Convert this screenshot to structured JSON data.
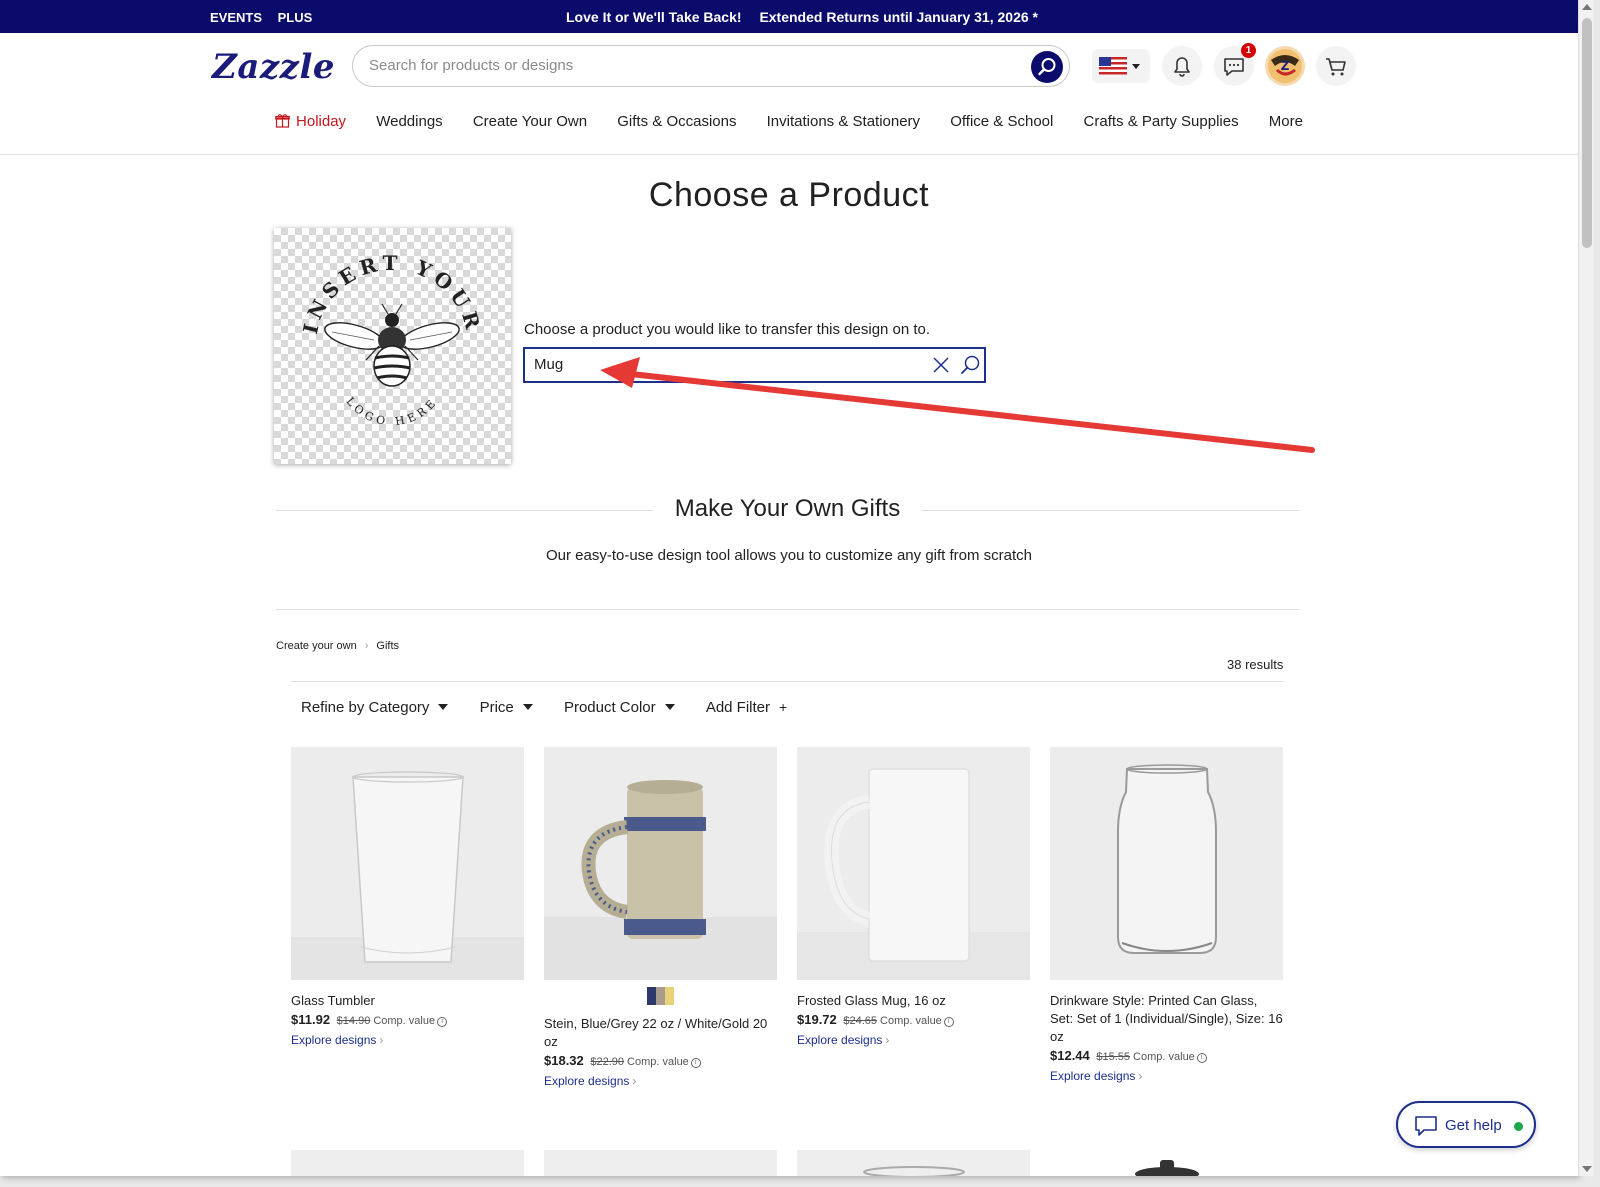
{
  "promo": {
    "links": [
      "EVENTS",
      "PLUS"
    ],
    "message_1": "Love It or We'll Take Back!",
    "message_2": "Extended Returns until January 31, 2026 *"
  },
  "header": {
    "logo": "Zazzle",
    "search_placeholder": "Search for products or designs",
    "messages_badge": "1"
  },
  "nav": [
    "Holiday",
    "Weddings",
    "Create Your Own",
    "Gifts & Occasions",
    "Invitations & Stationery",
    "Office & School",
    "Crafts & Party Supplies",
    "More"
  ],
  "main": {
    "title": "Choose a Product",
    "design_text_top": "INSERT YOUR",
    "design_text_bottom": "LOGO HERE",
    "choose_text": "Choose a product you would like to transfer this design on to.",
    "product_search_value": "Mug",
    "section_title": "Make Your Own Gifts",
    "section_subtitle": "Our easy-to-use design tool allows you to customize any gift from scratch"
  },
  "breadcrumb": [
    "Create your own",
    "Gifts"
  ],
  "results": "38 results",
  "filters": [
    "Refine by Category",
    "Price",
    "Product Color",
    "Add Filter"
  ],
  "products": [
    {
      "name": "Glass Tumbler",
      "price": "$11.92",
      "was": "$14.90",
      "comp": "Comp. value",
      "link": "Explore designs"
    },
    {
      "name": "Stein, Blue/Grey 22 oz / White/Gold 20 oz",
      "price": "$18.32",
      "was": "$22.90",
      "comp": "Comp. value",
      "link": "Explore designs"
    },
    {
      "name": "Frosted Glass Mug, 16 oz",
      "price": "$19.72",
      "was": "$24.65",
      "comp": "Comp. value",
      "link": "Explore designs"
    },
    {
      "name": "Drinkware Style: Printed Can Glass, Set: Set of 1 (Individual/Single), Size: 16 oz",
      "price": "$12.44",
      "was": "$15.55",
      "comp": "Comp. value",
      "link": "Explore designs"
    }
  ],
  "swatch_colors": [
    "#2b3a6b",
    "#a89c8a",
    "#e8d27a"
  ],
  "help": {
    "label": "Get help"
  },
  "colors": {
    "brand": "#0b0b6b",
    "holiday": "#c4161c",
    "link": "#1c2f8c",
    "arrow": "#e53935"
  }
}
